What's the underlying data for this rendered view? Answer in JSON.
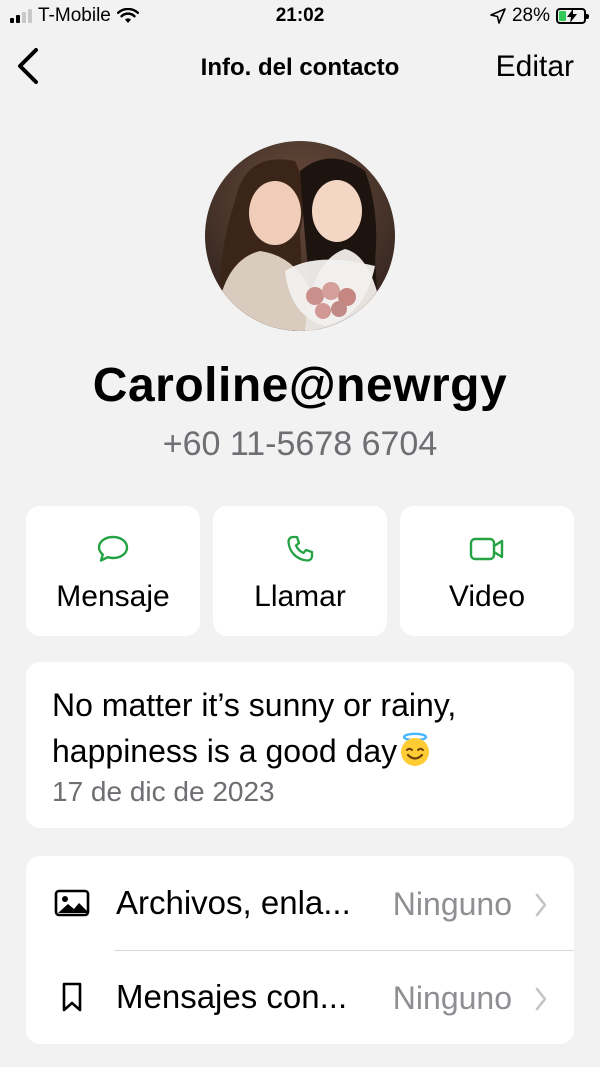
{
  "status_bar": {
    "carrier": "T-Mobile",
    "time": "21:02",
    "battery": "28%",
    "battery_level": 0.28,
    "icons": [
      "signal-icon",
      "wifi-icon",
      "location-arrow-icon",
      "battery-charging-icon"
    ]
  },
  "nav": {
    "title": "Info. del contacto",
    "edit_label": "Editar",
    "back_icon": "chevron-left-icon"
  },
  "contact": {
    "name": "Caroline@newrgy",
    "phone": "+60 11-5678 6704"
  },
  "actions": [
    {
      "label": "Mensaje",
      "icon": "message-bubble-icon"
    },
    {
      "label": "Llamar",
      "icon": "phone-icon"
    },
    {
      "label": "Video",
      "icon": "video-camera-icon"
    }
  ],
  "about": {
    "text": "No matter it’s sunny or rainy, happiness is a good day",
    "emoji_icon": "smiling-face-with-halo-icon",
    "date": "17 de dic de 2023"
  },
  "menu": [
    {
      "label": "Archivos, enla...",
      "value": "Ninguno",
      "icon": "photo-icon"
    },
    {
      "label": "Mensajes con...",
      "value": "Ninguno",
      "icon": "bookmark-icon"
    }
  ],
  "colors": {
    "background": "#f2f2f2",
    "card": "#ffffff",
    "accent_green": "#25a244",
    "secondary_text": "#6e6e73",
    "tertiary_text": "#8e8e93"
  }
}
